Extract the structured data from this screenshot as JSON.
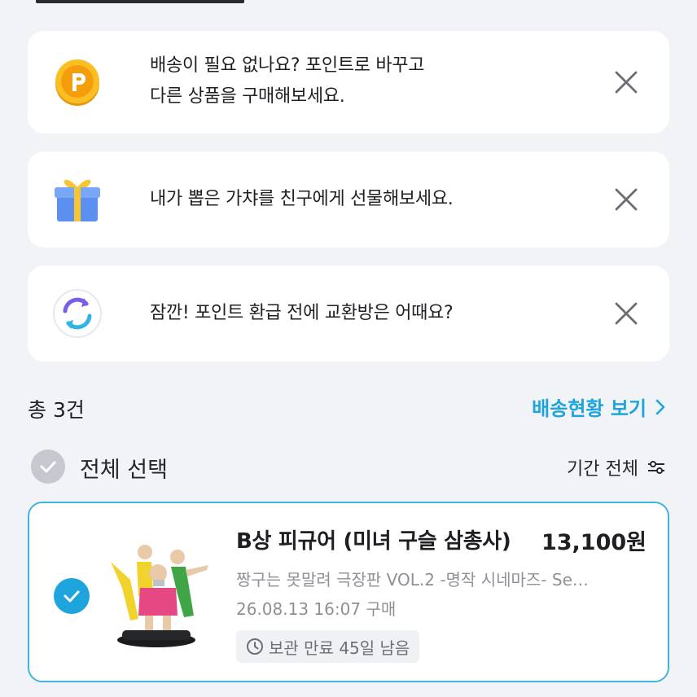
{
  "notices": [
    {
      "icon": "point-coin-icon",
      "lines": [
        "배송이 필요 없나요? 포인트로 바꾸고",
        "다른 상품을 구매해보세요."
      ]
    },
    {
      "icon": "gift-box-icon",
      "lines": [
        "내가 뽑은 가챠를 친구에게 선물해보세요."
      ]
    },
    {
      "icon": "exchange-refresh-icon",
      "lines": [
        "잠깐! 포인트 환급 전에 교환방은 어때요?"
      ]
    }
  ],
  "summary": {
    "total": "총 3건",
    "delivery_link": "배송현황 보기"
  },
  "select": {
    "all_label": "전체 선택",
    "period_label": "기간 전체"
  },
  "item": {
    "title": "B상 피규어 (미녀 구슬 삼총사)",
    "price": "13,100원",
    "subtitle": "짱구는 못말려 극장판 VOL.2 -명작 시네마즈- Se…",
    "date": "26.08.13 16:07 구매",
    "storage": "보관 만료 45일 남음",
    "checked": true
  },
  "colors": {
    "accent": "#1ea4dc",
    "card_border": "#3fb4df",
    "background": "#f2f3f7"
  }
}
